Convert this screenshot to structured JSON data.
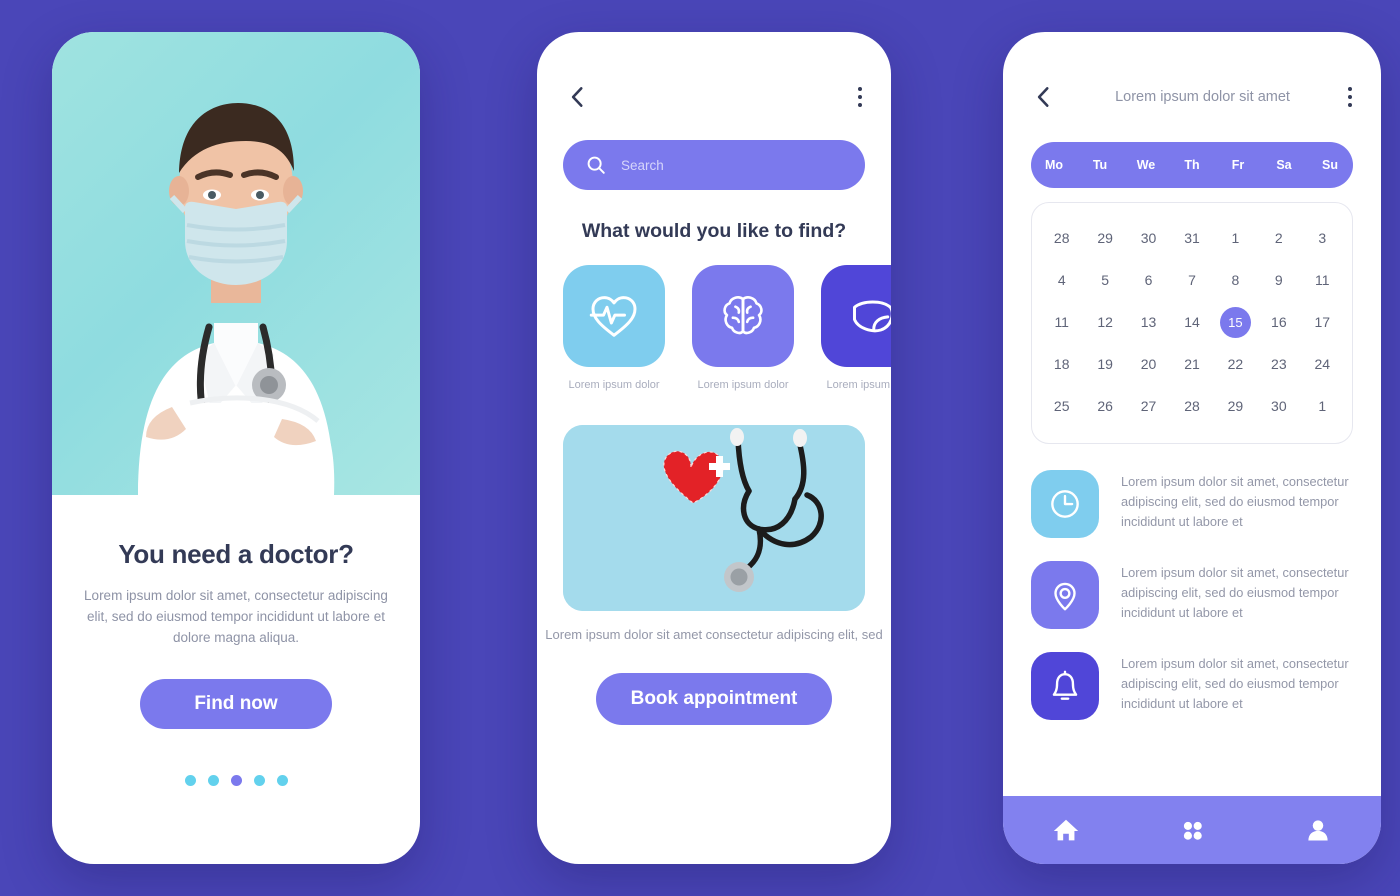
{
  "theme": {
    "background": "#4a46b8",
    "accent_purple": "#7b79ed",
    "accent_light_blue": "#7fcdee",
    "accent_deep_purple": "#5046d8",
    "nav_purple": "#8281ef",
    "heading_color": "#333a56",
    "body_text_color": "#9397a8"
  },
  "screen1": {
    "hero_image_alt": "doctor-wearing-face-mask-with-stethoscope",
    "title": "You need a doctor?",
    "subtitle": "Lorem ipsum dolor sit amet, consectetur adipiscing elit, sed do eiusmod tempor incididunt ut labore et dolore magna aliqua.",
    "cta_label": "Find now",
    "pagination": {
      "total": 5,
      "active_index": 2
    }
  },
  "screen2": {
    "header": {
      "back_icon": "chevron-left-icon",
      "menu_icon": "kebab-menu-icon",
      "title": ""
    },
    "search": {
      "icon": "search-icon",
      "placeholder": "Search",
      "value": ""
    },
    "section_title": "What would you like to find?",
    "categories": [
      {
        "icon": "heart-pulse-icon",
        "color": "#7fcdee",
        "label": "Lorem ipsum dolor"
      },
      {
        "icon": "brain-icon",
        "color": "#7b79ed",
        "label": "Lorem ipsum dolor"
      },
      {
        "icon": "liver-icon",
        "color": "#5046d8",
        "label": "Lorem ipsum dolor"
      }
    ],
    "promo": {
      "image_alt": "red-heart-with-white-cross-and-black-stethoscope-on-light-blue",
      "caption": "Lorem ipsum dolor sit amet consectetur adipiscing elit, sed"
    },
    "cta_label": "Book appointment"
  },
  "screen3": {
    "header": {
      "back_icon": "chevron-left-icon",
      "title": "Lorem ipsum dolor sit amet",
      "menu_icon": "kebab-menu-icon"
    },
    "calendar": {
      "weekdays": [
        "Mo",
        "Tu",
        "We",
        "Th",
        "Fr",
        "Sa",
        "Su"
      ],
      "selected_day": 15,
      "weeks": [
        [
          "28",
          "29",
          "30",
          "31",
          "1",
          "2",
          "3"
        ],
        [
          "4",
          "5",
          "6",
          "7",
          "8",
          "9",
          "11"
        ],
        [
          "11",
          "12",
          "13",
          "14",
          "15",
          "16",
          "17"
        ],
        [
          "18",
          "19",
          "20",
          "21",
          "22",
          "23",
          "24"
        ],
        [
          "25",
          "26",
          "27",
          "28",
          "29",
          "30",
          "1"
        ]
      ]
    },
    "features": [
      {
        "icon": "clock-icon",
        "color": "#7fcdee",
        "text": "Lorem ipsum dolor sit amet, consectetur adipiscing elit, sed do eiusmod tempor incididunt ut labore et"
      },
      {
        "icon": "location-pin-icon",
        "color": "#7b79ed",
        "text": "Lorem ipsum dolor sit amet, consectetur adipiscing elit, sed do eiusmod tempor incididunt ut labore et"
      },
      {
        "icon": "bell-icon",
        "color": "#5046d8",
        "text": "Lorem ipsum dolor sit amet, consectetur adipiscing elit, sed do eiusmod tempor incididunt ut labore et"
      }
    ],
    "bottom_nav": [
      {
        "icon": "home-icon",
        "label": ""
      },
      {
        "icon": "grid-icon",
        "label": ""
      },
      {
        "icon": "person-icon",
        "label": ""
      }
    ]
  }
}
